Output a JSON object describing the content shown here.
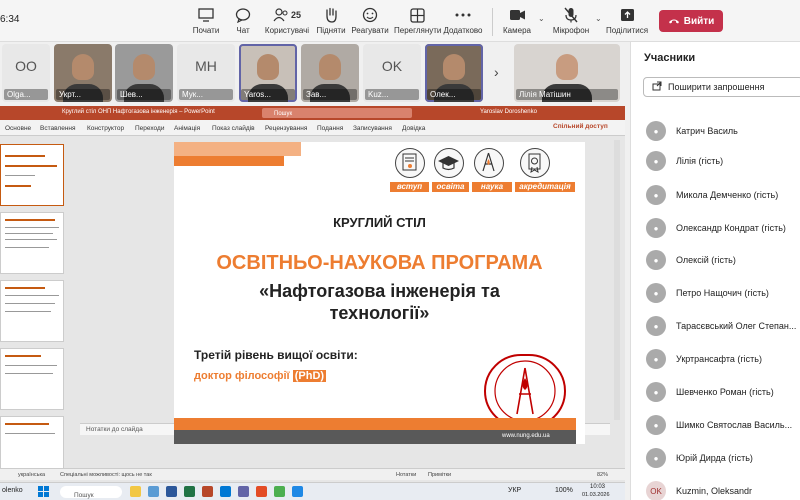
{
  "clock": "6:34",
  "toolbar": {
    "start": "Почати",
    "chat": "Чат",
    "people": "Користувачі",
    "people_count": "25",
    "raise": "Підняти",
    "react": "Реагувати",
    "view": "Переглянути",
    "more": "Додатково",
    "camera": "Камера",
    "mic": "Мікрофон",
    "share": "Поділитися",
    "leave": "Вийти"
  },
  "video_strip": [
    {
      "name": "Olga...",
      "initials": "OO",
      "type": "initials"
    },
    {
      "name": "Укрт...",
      "initials": "",
      "type": "video"
    },
    {
      "name": "Шев...",
      "initials": "",
      "type": "video"
    },
    {
      "name": "Мук...",
      "initials": "МН",
      "type": "initials"
    },
    {
      "name": "Yaros...",
      "initials": "",
      "type": "video"
    },
    {
      "name": "Зав...",
      "initials": "",
      "type": "video"
    },
    {
      "name": "Kuz...",
      "initials": "OK",
      "type": "initials"
    },
    {
      "name": "Олек...",
      "initials": "",
      "type": "video"
    },
    {
      "name": "Лілія Матішин",
      "initials": "",
      "type": "video"
    }
  ],
  "panel": {
    "title": "Учасники",
    "invite": "Поширити запрошення",
    "participants": [
      {
        "name": "Катрич Василь",
        "initials": ""
      },
      {
        "name": "Лілія (гість)",
        "initials": ""
      },
      {
        "name": "Микола Демченко (гість)",
        "initials": ""
      },
      {
        "name": "Олександр Кондрат (гість)",
        "initials": ""
      },
      {
        "name": "Олексій (гість)",
        "initials": ""
      },
      {
        "name": "Петро Нащочич (гість)",
        "initials": ""
      },
      {
        "name": "Тарасєвський Олег Степан...",
        "initials": ""
      },
      {
        "name": "Укртрансафта (гість)",
        "initials": ""
      },
      {
        "name": "Шевченко Роман (гість)",
        "initials": ""
      },
      {
        "name": "Шимко Святослав Василь...",
        "initials": ""
      },
      {
        "name": "Юрій Дирда (гість)",
        "initials": ""
      },
      {
        "name": "Kuzmin, Oleksandr",
        "initials": "OK"
      }
    ]
  },
  "ppt": {
    "title": "Круглий стіл ОНП Нафтогазова інженерія – PowerPoint",
    "search": "Пошук",
    "user": "Yaroslav Doroshenko",
    "tabs": [
      "Основне",
      "Вставлення",
      "Конструктор",
      "Переходи",
      "Анімація",
      "Показ слайдів",
      "Рецензування",
      "Подання",
      "Записування",
      "Довідка"
    ],
    "share": "Спільний доступ",
    "notes": "Нотатки до слайда",
    "status": {
      "lang": "українська",
      "access": "Спеціальні можливості: щось не так",
      "notes_btn": "Нотатки",
      "comments_btn": "Примітки",
      "zoom": "82%"
    }
  },
  "slide": {
    "categories": [
      "вступ",
      "освіта",
      "наука",
      "акредитація"
    ],
    "round_table": "КРУГЛИЙ СТІЛ",
    "program": "ОСВІТНЬО-НАУКОВА ПРОГРАМА",
    "name_line1": "«Нафтогазова інженерія та",
    "name_line2": "технології»",
    "level": "Третій рівень вищої освіти:",
    "degree": "доктор філософії",
    "phd": "(PhD)",
    "url": "www.nung.edu.ua"
  },
  "taskbar": {
    "user": "olenko",
    "search": "Пошук",
    "lang": "УКР",
    "battery": "100%",
    "time": "10:03",
    "date": "01.03.2026"
  }
}
